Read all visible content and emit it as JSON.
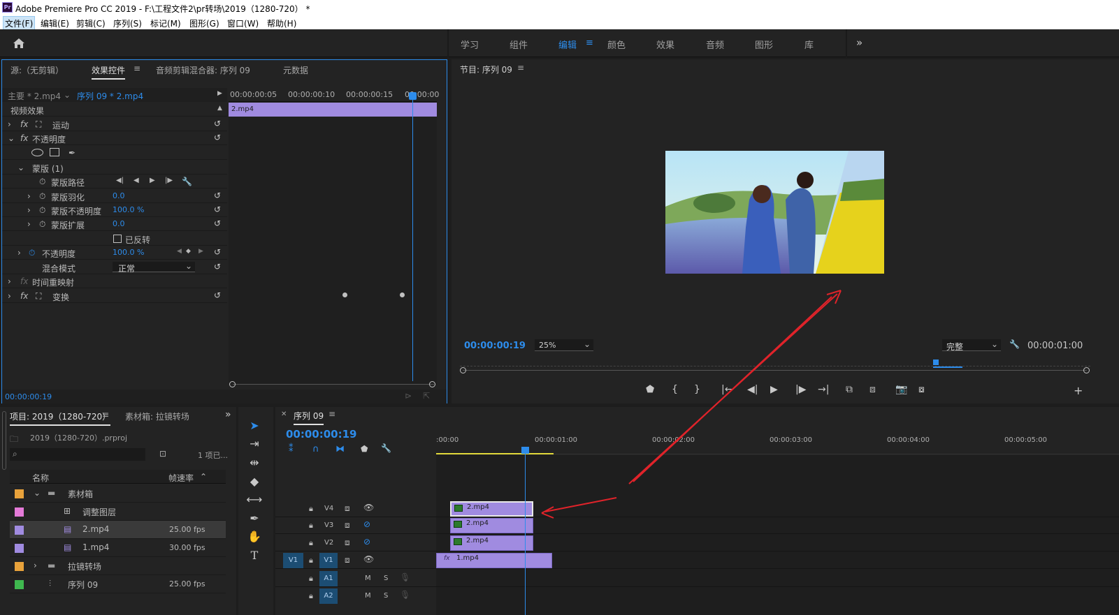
{
  "titlebar": {
    "app_icon": "Pr",
    "title": "Adobe Premiere Pro CC 2019 - F:\\工程文件2\\pr转场\\2019（1280-720） *"
  },
  "menu": [
    "文件(F)",
    "编辑(E)",
    "剪辑(C)",
    "序列(S)",
    "标记(M)",
    "图形(G)",
    "窗口(W)",
    "帮助(H)"
  ],
  "workspaces": [
    "学习",
    "组件",
    "编辑",
    "颜色",
    "效果",
    "音频",
    "图形",
    "库"
  ],
  "active_workspace": "编辑",
  "effect_panel": {
    "tabs": [
      "源:（无剪辑）",
      "效果控件",
      "音频剪辑混合器: 序列 09",
      "元数据"
    ],
    "master": "主要 * 2.mp4",
    "sequence": "序列 09 * 2.mp4",
    "ruler": [
      "00:00:00:05",
      "00:00:00:10",
      "00:00:00:15",
      "00:00:00"
    ],
    "clip_name": "2.mp4",
    "section": "视频效果",
    "rows": {
      "motion": "运动",
      "opacity": "不透明度",
      "mask": "蒙版 (1)",
      "mask_path": "蒙版路径",
      "mask_feather": "蒙版羽化",
      "mask_feather_val": "0.0",
      "mask_opacity": "蒙版不透明度",
      "mask_opacity_val": "100.0 %",
      "mask_expand": "蒙版扩展",
      "mask_expand_val": "0.0",
      "inverted": "已反转",
      "opacity2": "不透明度",
      "opacity2_val": "100.0 %",
      "blend": "混合模式",
      "blend_val": "正常",
      "time_remap": "时间重映射",
      "transform": "变换"
    },
    "timecode": "00:00:00:19"
  },
  "program": {
    "title": "节目: 序列 09",
    "timecode": "00:00:00:19",
    "zoom": "25%",
    "quality": "完整",
    "duration": "00:00:01:00"
  },
  "project": {
    "tabs": [
      "项目: 2019（1280-720）",
      "素材箱: 拉镜转场"
    ],
    "file": "2019（1280-720）.prproj",
    "count": "1 项已...",
    "col_name": "名称",
    "col_fps": "帧速率",
    "items": [
      {
        "name": "素材箱",
        "fps": "",
        "color": "#e8a23b"
      },
      {
        "name": "调整图层",
        "fps": "",
        "color": "#e47ad8"
      },
      {
        "name": "2.mp4",
        "fps": "25.00 fps",
        "color": "#a08be0"
      },
      {
        "name": "1.mp4",
        "fps": "30.00 fps",
        "color": "#a08be0"
      },
      {
        "name": "拉镜转场",
        "fps": "",
        "color": "#e8a23b"
      },
      {
        "name": "序列 09",
        "fps": "25.00 fps",
        "color": "#3fb84f"
      }
    ]
  },
  "timeline": {
    "tab": "序列 09",
    "timecode": "00:00:00:19",
    "ruler": [
      ":00:00",
      "00:00:01:00",
      "00:00:02:00",
      "00:00:03:00",
      "00:00:04:00",
      "00:00:05:00"
    ],
    "tracks": [
      "V4",
      "V3",
      "V2",
      "V1",
      "A1",
      "A2"
    ],
    "source_patch": [
      "V1"
    ],
    "clips": [
      {
        "track": "V4",
        "name": "2.mp4"
      },
      {
        "track": "V3",
        "name": "2.mp4"
      },
      {
        "track": "V2",
        "name": "2.mp4"
      },
      {
        "track": "V1",
        "name": "1.mp4"
      }
    ],
    "audio_labels": [
      "M",
      "S"
    ]
  },
  "colors": {
    "accent": "#2d8ceb",
    "clip": "#a08be0",
    "annotation": "#e0232a"
  }
}
